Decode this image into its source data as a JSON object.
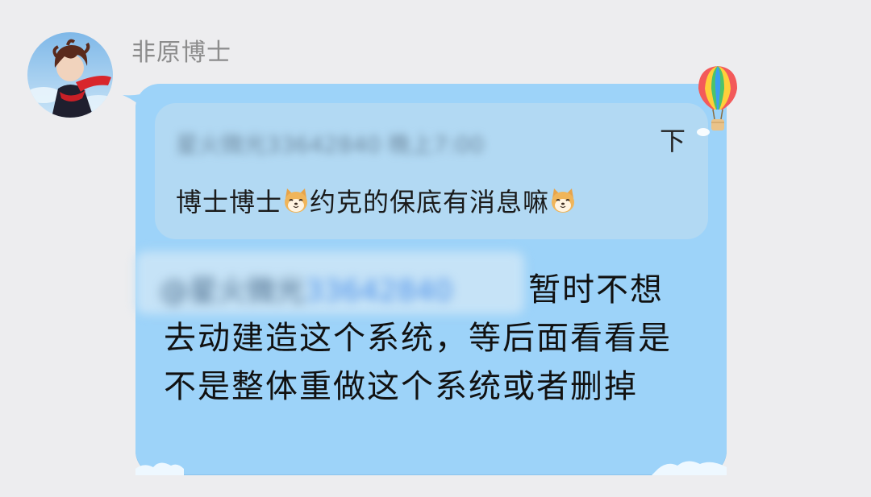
{
  "sender": {
    "name": "非原博士"
  },
  "quote": {
    "meta": "星火微光3364284​0 晚上7:00",
    "meta_tail": "下",
    "text_before": "博士博士",
    "text_middle": "约克的保底有消息嘛",
    "emoji": "shiba-face"
  },
  "reply": {
    "mention_prefix": "@星火微光",
    "mention_number": "3364284​0",
    "line1": "暂时不想",
    "body": "去动建造这个系统，等后面看看是不是整体重做这个系统或者删掉"
  },
  "colors": {
    "background": "#ededef",
    "bubble": "#9dd3f9",
    "quote_box": "#b2d9f3",
    "text": "#111111",
    "sender_name": "#8c8c8c"
  }
}
